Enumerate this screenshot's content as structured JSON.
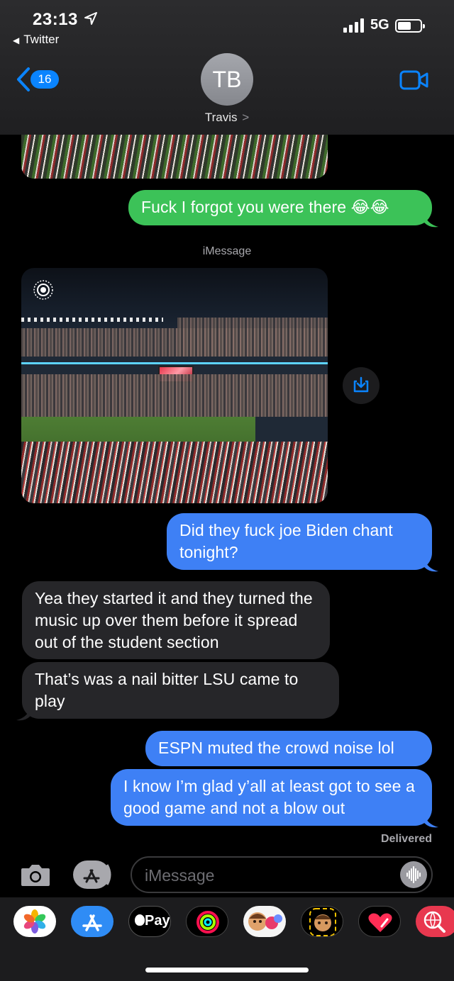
{
  "status_bar": {
    "time": "23:13",
    "back_app": "Twitter",
    "network": "5G"
  },
  "nav": {
    "back_count": "16",
    "contact_initials": "TB",
    "contact_name": "Travis",
    "name_chevron": ">"
  },
  "thread": {
    "service_label": "iMessage",
    "messages": [
      {
        "from": "me",
        "style": "green",
        "text": "Fuck I forgot you were there 😂😂"
      },
      {
        "from": "them",
        "type": "photo",
        "icon": "live-photo-icon"
      },
      {
        "from": "me",
        "style": "blue",
        "text": "Did they fuck joe Biden chant tonight?"
      },
      {
        "from": "them",
        "style": "gray",
        "text": "Yea they started it and they turned the music up over them before it spread out of the student section"
      },
      {
        "from": "them",
        "style": "gray",
        "text": "That’s was a nail bitter LSU came to play"
      },
      {
        "from": "me",
        "style": "blue",
        "text": "ESPN muted the crowd noise lol"
      },
      {
        "from": "me",
        "style": "blue",
        "text": "I know I’m glad y’all at least got to see a good game and not a blow out"
      }
    ],
    "delivered_label": "Delivered"
  },
  "input": {
    "placeholder": "iMessage"
  },
  "drawer": {
    "apps": [
      "photos-app",
      "app-store",
      "apple-pay",
      "activity",
      "memoji-stickers",
      "animoji",
      "digital-touch",
      "web-search"
    ],
    "apple_pay_label": "Pay"
  },
  "colors": {
    "sms_green": "#3cc258",
    "imessage_blue": "#3e80f5",
    "received_gray": "#262629",
    "accent_blue": "#0a84ff"
  }
}
